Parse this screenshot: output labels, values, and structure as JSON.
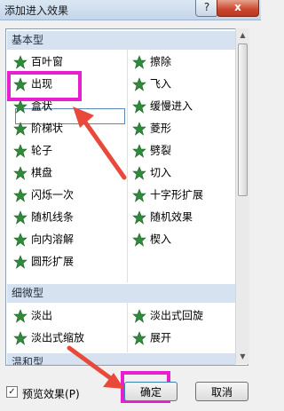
{
  "window": {
    "title": "添加进入效果",
    "help": "?",
    "close": "x"
  },
  "categories": {
    "basic": "基本型",
    "subtle": "细微型",
    "moderate": "温和型"
  },
  "basic_left": [
    "百叶窗",
    "出现",
    "盒状",
    "阶梯状",
    "轮子",
    "棋盘",
    "闪烁一次",
    "随机线条",
    "向内溶解",
    "圆形扩展"
  ],
  "basic_right": [
    "擦除",
    "飞入",
    "缓慢进入",
    "菱形",
    "劈裂",
    "切入",
    "十字形扩展",
    "随机效果",
    "楔入"
  ],
  "subtle_left": [
    "淡出",
    "淡出式缩放"
  ],
  "subtle_right": [
    "淡出式回旋",
    "展开"
  ],
  "footer": {
    "preview_label": "预览效果",
    "preview_key": "P",
    "preview_checked": "✓",
    "ok": "确定",
    "cancel": "取消"
  },
  "colors": {
    "accent": "#e81fcf",
    "arrow": "#e8493a",
    "icon": "#2e8b3a"
  },
  "icons": {
    "effect": "star-icon",
    "arrow": "red-arrow"
  }
}
